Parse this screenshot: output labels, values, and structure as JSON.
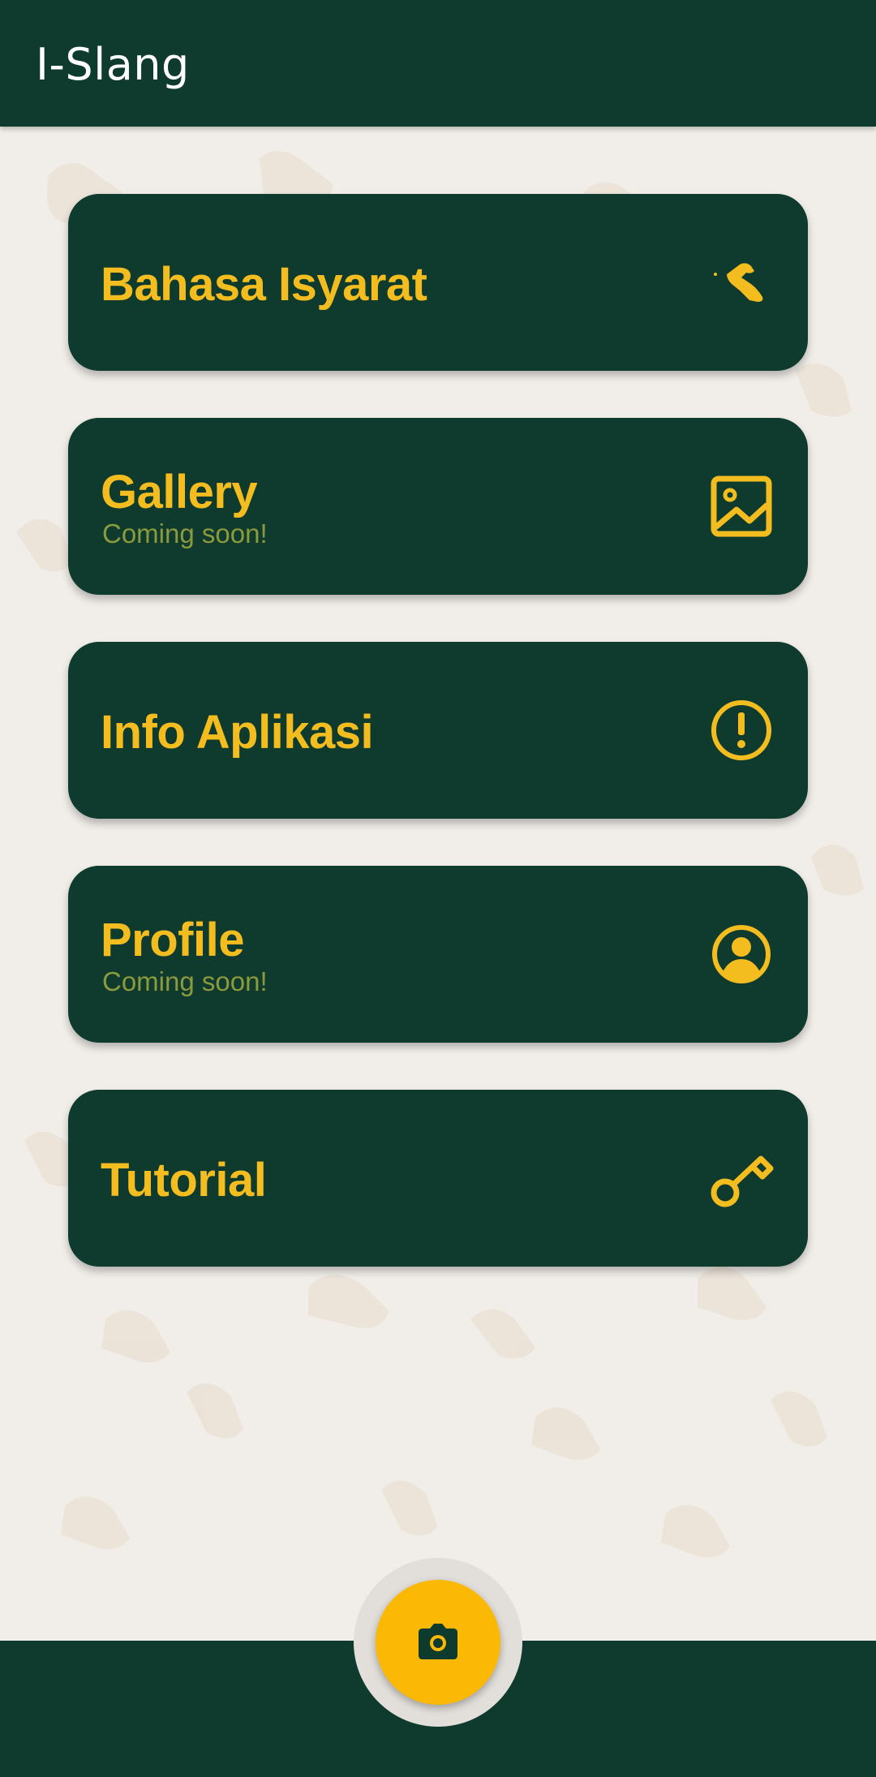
{
  "app": {
    "title": "I-Slang"
  },
  "menu": {
    "items": [
      {
        "title": "Bahasa Isyarat",
        "subtitle": "",
        "icon": "hand-sign-icon"
      },
      {
        "title": "Gallery",
        "subtitle": "Coming soon!",
        "icon": "image-icon"
      },
      {
        "title": "Info Aplikasi",
        "subtitle": "",
        "icon": "info-circle-icon"
      },
      {
        "title": "Profile",
        "subtitle": "Coming soon!",
        "icon": "account-circle-icon"
      },
      {
        "title": "Tutorial",
        "subtitle": "",
        "icon": "key-icon"
      }
    ]
  },
  "fab": {
    "icon": "camera-icon"
  },
  "colors": {
    "primary": "#0f3a2e",
    "accent": "#f4bd1f",
    "subtitle": "#8a9a3c",
    "fab": "#fbb906",
    "background": "#f1eee9"
  }
}
